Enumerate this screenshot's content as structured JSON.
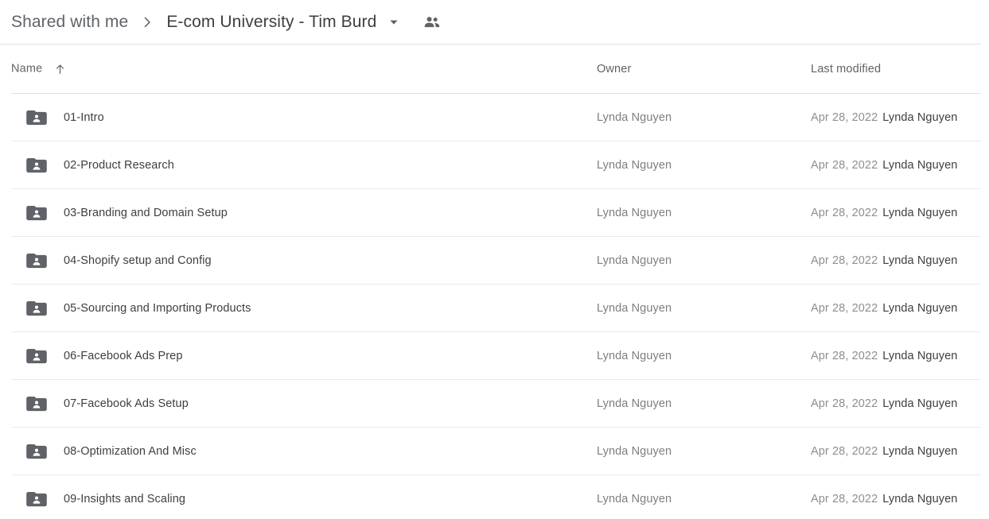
{
  "breadcrumb": {
    "parent_label": "Shared with me",
    "separator_icon": "chevron-right-icon",
    "current_label": "E-com University - Tim Burd",
    "caret_icon": "chevron-down-icon",
    "people_icon": "people-shared-icon"
  },
  "columns": {
    "name": "Name",
    "sort_icon": "sort-ascending-arrow-icon",
    "owner": "Owner",
    "last_modified": "Last modified"
  },
  "colors": {
    "folder_icon": "#5f6368",
    "divider": "#e8eaed",
    "text_primary": "#3c4043",
    "text_secondary": "#5f6368",
    "text_muted": "#8a8f94",
    "background": "#ffffff"
  },
  "files": [
    {
      "icon": "shared-folder-icon",
      "name": "01-Intro",
      "owner": "Lynda Nguyen",
      "modified_date": "Apr 28, 2022",
      "modified_by": "Lynda Nguyen"
    },
    {
      "icon": "shared-folder-icon",
      "name": "02-Product Research",
      "owner": "Lynda Nguyen",
      "modified_date": "Apr 28, 2022",
      "modified_by": "Lynda Nguyen"
    },
    {
      "icon": "shared-folder-icon",
      "name": "03-Branding and Domain Setup",
      "owner": "Lynda Nguyen",
      "modified_date": "Apr 28, 2022",
      "modified_by": "Lynda Nguyen"
    },
    {
      "icon": "shared-folder-icon",
      "name": "04-Shopify setup and Config",
      "owner": "Lynda Nguyen",
      "modified_date": "Apr 28, 2022",
      "modified_by": "Lynda Nguyen"
    },
    {
      "icon": "shared-folder-icon",
      "name": "05-Sourcing and Importing Products",
      "owner": "Lynda Nguyen",
      "modified_date": "Apr 28, 2022",
      "modified_by": "Lynda Nguyen"
    },
    {
      "icon": "shared-folder-icon",
      "name": "06-Facebook Ads Prep",
      "owner": "Lynda Nguyen",
      "modified_date": "Apr 28, 2022",
      "modified_by": "Lynda Nguyen"
    },
    {
      "icon": "shared-folder-icon",
      "name": "07-Facebook Ads Setup",
      "owner": "Lynda Nguyen",
      "modified_date": "Apr 28, 2022",
      "modified_by": "Lynda Nguyen"
    },
    {
      "icon": "shared-folder-icon",
      "name": "08-Optimization And Misc",
      "owner": "Lynda Nguyen",
      "modified_date": "Apr 28, 2022",
      "modified_by": "Lynda Nguyen"
    },
    {
      "icon": "shared-folder-icon",
      "name": "09-Insights and Scaling",
      "owner": "Lynda Nguyen",
      "modified_date": "Apr 28, 2022",
      "modified_by": "Lynda Nguyen"
    }
  ]
}
